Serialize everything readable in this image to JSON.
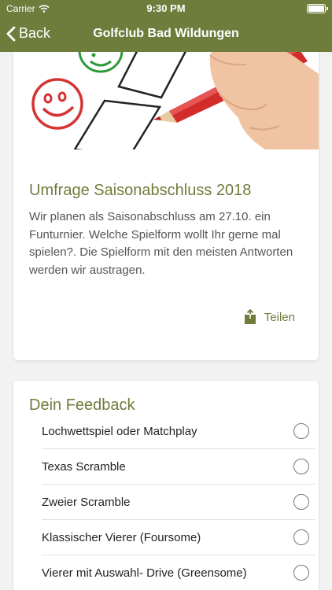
{
  "status_bar": {
    "carrier": "Carrier",
    "time": "9:30 PM"
  },
  "nav": {
    "back_label": "Back",
    "title": "Golfclub Bad Wildungen"
  },
  "post": {
    "title": "Umfrage Saisonabschluss 2018",
    "body": "Wir planen als Saisonabschluss am 27.10. ein Funturnier. Welche Spielform wollt Ihr gerne mal spielen?. Die Spielform mit den meisten Antworten werden wir austragen.",
    "share_label": "Teilen"
  },
  "feedback": {
    "title": "Dein Feedback",
    "options": [
      {
        "label": "Lochwettspiel oder Matchplay"
      },
      {
        "label": "Texas Scramble"
      },
      {
        "label": "Zweier Scramble"
      },
      {
        "label": "Klassischer Vierer (Foursome)"
      },
      {
        "label": "Vierer mit Auswahl- Drive (Greensome)"
      }
    ]
  },
  "colors": {
    "brand": "#6e7d3c",
    "background": "#f2f2f2"
  }
}
